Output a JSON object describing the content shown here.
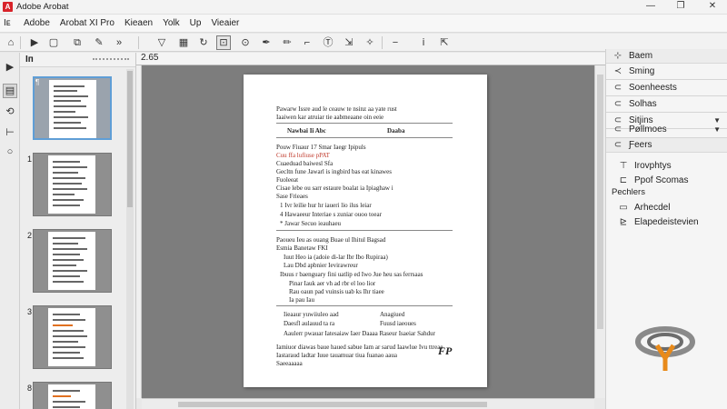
{
  "window": {
    "title": "Adobe Arobat",
    "minimize": "—",
    "maximize": "❐",
    "close": "✕",
    "app_icon": "acrobat-icon"
  },
  "menu": {
    "icon": "Ιᴇ",
    "items": [
      "Adobe",
      "Arobat XI Pro",
      "Kieaen",
      "Yolk",
      "Up",
      "Vieaier"
    ]
  },
  "toolbar": {
    "page_indicator": "2.65"
  },
  "thumbnails": {
    "label": "Iп",
    "pages": [
      {
        "num": "",
        "selected": true
      },
      {
        "num": "1",
        "selected": false
      },
      {
        "num": "2",
        "selected": false
      },
      {
        "num": "3",
        "selected": false
      },
      {
        "num": "8",
        "selected": false
      }
    ]
  },
  "document": {
    "lines": [
      "Pawarw Issre aud le ceauw te nsinz aa yate rust",
      "Iaaiwen kar atruiar tie aabmeaane oin eeie",
      "Nawbai Ii    Abc",
      "Daaba",
      "Pouw Fiuaur 17 Smar Iaegr Ipipuls",
      "Cuu ffa lufiuse pPAT",
      "Cuaeduad baiwesl Sfa",
      "Gecltn fune Jawarl is ingbird bas eat kinawes",
      "Fuoleeat",
      "Cisae lebe ou sarr estaure boalat ia Ipiaghaw i",
      "Sase Frieaes",
      "1    Ivr leilie hur hr iaueri lio ilus leiar",
      "4      Hawaeeur Interiae s zuniar ouoo toear",
      "*        Jawar Secuo ieauhaeu",
      "Paoueu Ieu as ouang Buae ul Ihitul Bagsad",
      "Esmia Banetaw FKI",
      "Iuut Heo ia (adoie di-lar Ibr Ibo  Rupiraa)",
      "Lau Dbd apbnier Ievirawreur",
      "Ibuus r baenguary fini uatlip ed Iwo Jue heu sas ferrsaas",
      "Pinar Iauk aer vh ad rbr el loo lior",
      "Rau oaun pad vuinsis uab ks Ihr tiaee",
      "Ia pau Iau",
      "Iieaaur yuwiiuleo aad",
      "Anagiued",
      "Daesfl aulauud ta ra",
      "Fuusd iaeoues",
      "Aaulerr pwauar Iatesaiaw    Iaer Daaaa   Raseur Isaeiar   Sahdur",
      "Iamiuor diawas baue haued sabue Iam ar sarud Iaawlue Ivu ttreae",
      "Iastaraud ladtar Iuue tauamuar tiua fuanao aaua",
      "Saeeaaaaa",
      "FP"
    ]
  },
  "right_panel": {
    "items": [
      {
        "label": "Baem",
        "icon": "bookmark-icon"
      },
      {
        "label": "Sming",
        "icon": "sign-icon"
      },
      {
        "label": "Soenheests",
        "icon": "comment-icon"
      },
      {
        "label": "Solhas",
        "icon": "tools-icon"
      },
      {
        "label": "Sitjins",
        "icon": "settings-icon"
      },
      {
        "label": "Pøllmoes",
        "icon": "protection-icon"
      },
      {
        "label": "Ƒeers",
        "icon": "forms-icon"
      }
    ],
    "subitems": [
      {
        "label": "Irovphtys",
        "icon": "text-icon"
      },
      {
        "label": "Ppof Scomas",
        "icon": "frame-icon"
      }
    ],
    "section_label": "Pechlers",
    "subitems2": [
      {
        "label": "Arhecdel",
        "icon": "doc-icon"
      },
      {
        "label": "Elapedeistevien",
        "icon": "edit-icon"
      }
    ]
  },
  "colors": {
    "accent": "#d8232a",
    "selection": "#5f9ed6",
    "logo_grey": "#6c6c6c",
    "logo_orange": "#e88a1a"
  }
}
